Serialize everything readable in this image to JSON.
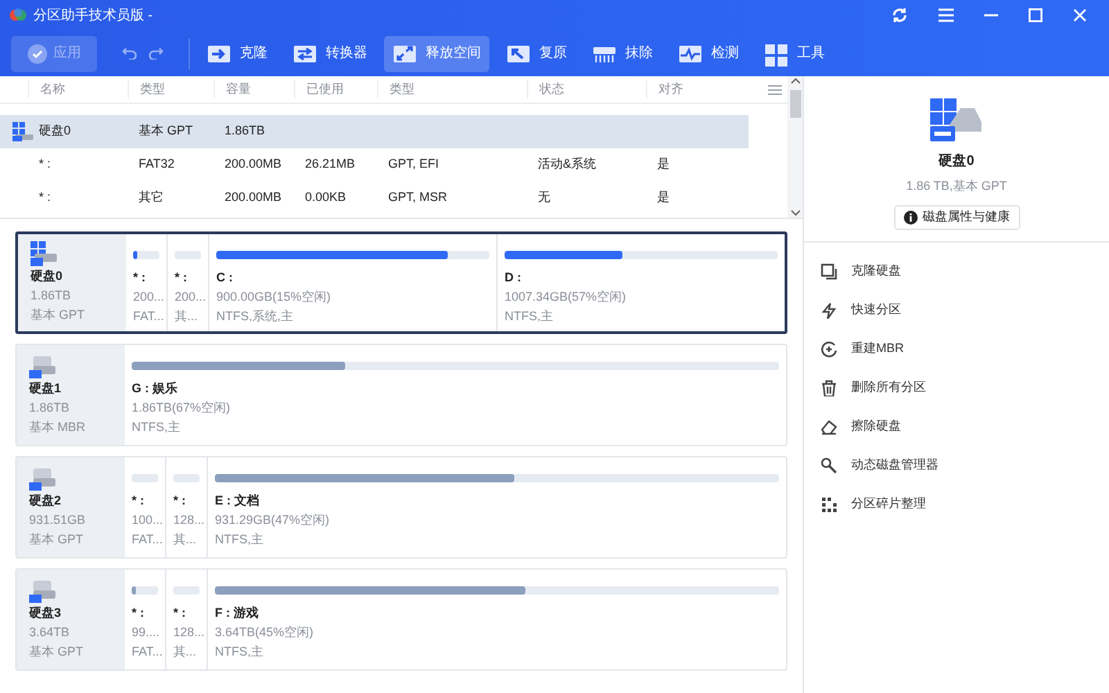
{
  "window": {
    "title": "分区助手技术员版 -"
  },
  "toolbar": {
    "apply": {
      "label": "应用",
      "disabled": true
    },
    "tools": [
      {
        "label": "克隆",
        "kind": "clone",
        "selected": false
      },
      {
        "label": "转换器",
        "kind": "convert",
        "selected": false
      },
      {
        "label": "释放空间",
        "kind": "free",
        "selected": true
      },
      {
        "label": "复原",
        "kind": "restore",
        "selected": false
      },
      {
        "label": "抹除",
        "kind": "wipe",
        "selected": false
      },
      {
        "label": "检测",
        "kind": "test",
        "selected": false
      },
      {
        "label": "工具",
        "kind": "tools",
        "selected": false
      }
    ]
  },
  "table": {
    "columns": [
      "名称",
      "类型",
      "容量",
      "已使用",
      "类型",
      "状态",
      "对齐"
    ],
    "rows": [
      {
        "kind": "disk",
        "selected": true,
        "cells": [
          "硬盘0",
          "基本 GPT",
          "1.86TB"
        ]
      },
      {
        "kind": "partition",
        "selected": false,
        "cells": [
          "* :",
          "FAT32",
          "200.00MB",
          "26.21MB",
          "GPT, EFI",
          "活动&系统",
          "是"
        ]
      },
      {
        "kind": "partition",
        "selected": false,
        "cells": [
          "* :",
          "其它",
          "200.00MB",
          "0.00KB",
          "GPT, MSR",
          "无",
          "是"
        ]
      }
    ]
  },
  "disks": [
    {
      "name": "硬盘0",
      "size": "1.86TB",
      "type": "基本 GPT",
      "kind": "system",
      "selected": true,
      "partitions": [
        {
          "kind": "small",
          "label": "* :",
          "size": "200...",
          "info": "FAT...",
          "level": 0.15
        },
        {
          "kind": "small",
          "label": "* :",
          "size": "200...",
          "info": "其...",
          "level": 0
        },
        {
          "kind": "large",
          "label": "C :",
          "size": "900.00GB(15%空闲)",
          "info": "NTFS,系统,主",
          "level": 0.85
        },
        {
          "kind": "large",
          "label": "D :",
          "size": "1007.34GB(57%空闲)",
          "info": "NTFS,主",
          "level": 0.43
        }
      ]
    },
    {
      "name": "硬盘1",
      "size": "1.86TB",
      "type": "基本 MBR",
      "kind": "data",
      "selected": false,
      "partitions": [
        {
          "kind": "large",
          "label": "G : 娱乐",
          "size": "1.86TB(67%空闲)",
          "info": "NTFS,主",
          "level": 0.33
        }
      ]
    },
    {
      "name": "硬盘2",
      "size": "931.51GB",
      "type": "基本 GPT",
      "kind": "data",
      "selected": false,
      "partitions": [
        {
          "kind": "small",
          "label": "* :",
          "size": "100...",
          "info": "FAT...",
          "level": 0
        },
        {
          "kind": "small",
          "label": "* :",
          "size": "128...",
          "info": "其...",
          "level": 0
        },
        {
          "kind": "large",
          "label": "E : 文档",
          "size": "931.29GB(47%空闲)",
          "info": "NTFS,主",
          "level": 0.53
        }
      ]
    },
    {
      "name": "硬盘3",
      "size": "3.64TB",
      "type": "基本 GPT",
      "kind": "data",
      "selected": false,
      "partitions": [
        {
          "kind": "small",
          "label": "* :",
          "size": "99....",
          "info": "FAT...",
          "level": 0.15
        },
        {
          "kind": "small",
          "label": "* :",
          "size": "128...",
          "info": "其...",
          "level": 0
        },
        {
          "kind": "large",
          "label": "F : 游戏",
          "size": "3.64TB(45%空闲)",
          "info": "NTFS,主",
          "level": 0.55
        }
      ]
    }
  ],
  "details": {
    "name": "硬盘0",
    "summary": "1.86 TB,基本 GPT",
    "button": "磁盘属性与健康",
    "actions": [
      {
        "label": "克隆硬盘",
        "kind": "clone"
      },
      {
        "label": "快速分区",
        "kind": "quick"
      },
      {
        "label": "重建MBR",
        "kind": "rebuild"
      },
      {
        "label": "删除所有分区",
        "kind": "delete"
      },
      {
        "label": "擦除硬盘",
        "kind": "erase"
      },
      {
        "label": "动态磁盘管理器",
        "kind": "dynamic"
      },
      {
        "label": "分区碎片整理",
        "kind": "defrag"
      }
    ]
  }
}
